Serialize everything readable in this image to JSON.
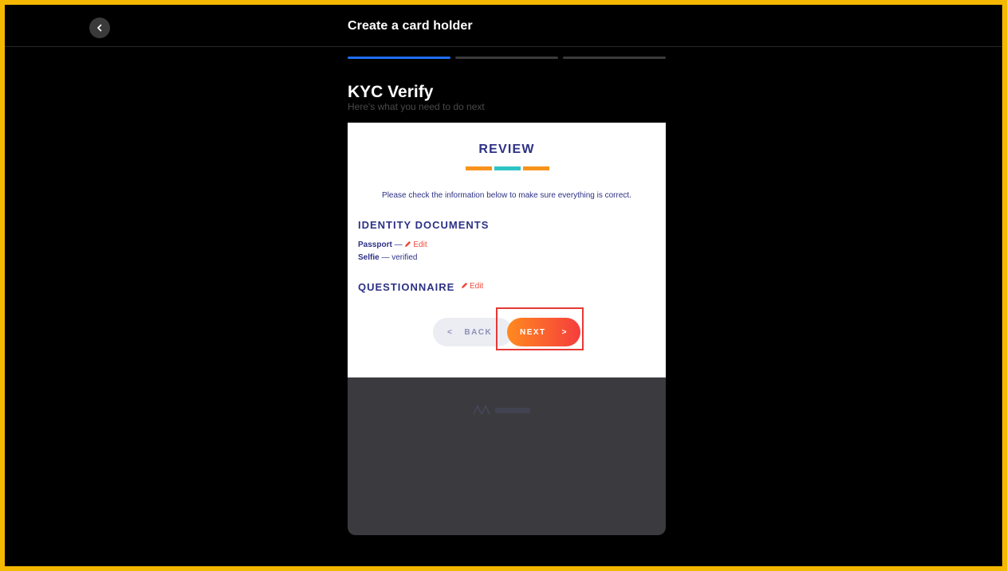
{
  "header": {
    "title": "Create a card holder",
    "back_icon": "chevron-left-icon"
  },
  "progress": {
    "steps_total": 3,
    "current_step": 1
  },
  "page": {
    "title": "KYC Verify",
    "subtitle": "Here's what you need to do next"
  },
  "review": {
    "title": "REVIEW",
    "instructions": "Please check the information below to make sure everything is correct.",
    "identity_heading": "IDENTITY DOCUMENTS",
    "passport_label": "Passport",
    "passport_sep": " — ",
    "passport_edit": "Edit",
    "selfie_label": "Selfie",
    "selfie_status": " — verified",
    "questionnaire_heading": "QUESTIONNAIRE",
    "questionnaire_edit": "Edit",
    "back_button": "BACK",
    "back_chevron": "<",
    "next_button": "NEXT",
    "next_chevron": ">"
  },
  "colors": {
    "accent_blue": "#1e6ef5",
    "navy_text": "#2d3184",
    "edit_red": "#ef4a3c",
    "deco_orange": "#f7941d",
    "deco_teal": "#2ec4c4",
    "next_gradient_start": "#ff8a1f",
    "next_gradient_end": "#f53d3d",
    "frame_border": "#f5b800",
    "highlight_border": "#e53935"
  }
}
